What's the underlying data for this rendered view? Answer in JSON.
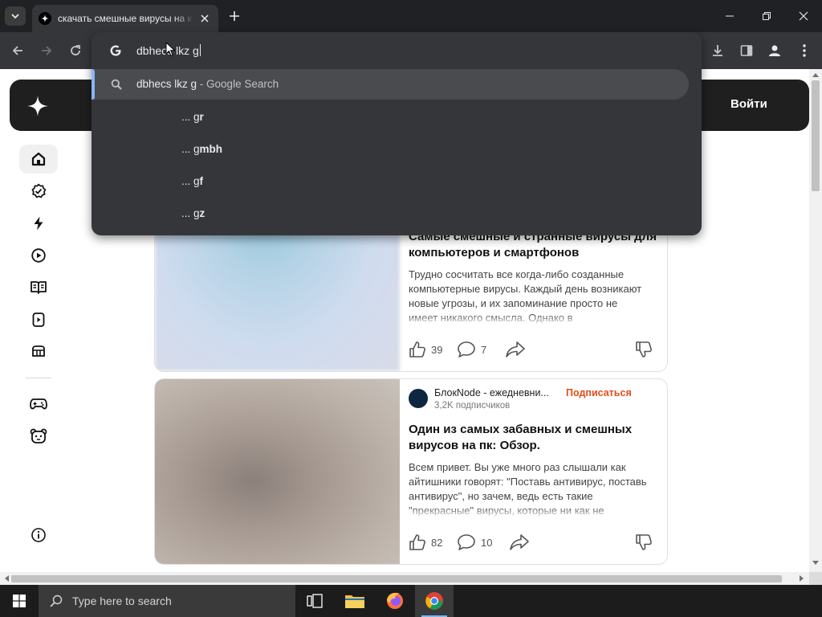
{
  "browser": {
    "tab": {
      "title": "скачать смешные вирусы на к"
    },
    "omnibox": {
      "typed_text": "dbhecs lkz g",
      "selected_suggestion": {
        "query": "dbhecs lkz g",
        "suffix": " - Google Search"
      },
      "suggestions": [
        {
          "prefix": "... g",
          "bold": "r"
        },
        {
          "prefix": "... g",
          "bold": "mbh"
        },
        {
          "prefix": "... g",
          "bold": "f"
        },
        {
          "prefix": "... g",
          "bold": "z"
        }
      ]
    }
  },
  "site": {
    "login_label": "Войти",
    "nav_icons": [
      "home-icon",
      "popular-icon",
      "lightning-icon",
      "video-icon",
      "book-icon",
      "tv-icon",
      "cube-icon",
      "gamepad-icon",
      "bear-icon",
      "info-icon"
    ]
  },
  "articles": [
    {
      "title_line1": "Самые смешные и странные вирусы для",
      "title_line2": "компьютеров и смартфонов",
      "text": "Трудно сосчитать все когда-либо созданные компьютерные вирусы. Каждый день возникают новые угрозы, и их запоминание просто не имеет никакого смысла. Однако в",
      "likes": "39",
      "comments": "7"
    },
    {
      "author": "БлокNode - ежедневни...",
      "subscribe_label": "Подписаться",
      "subscribers": "3,2K подписчиков",
      "title_line1": "Один из самых забавных и смешных",
      "title_line2": "вирусов на пк: Обзор.",
      "text": "Всем привет. Вы уже много раз слышали как айтишники говорят: \"Поставь антивирус, поставь антивирус\", но зачем, ведь есть такие \"прекрасные\" вирусы, которые ни как не",
      "likes": "82",
      "comments": "10"
    }
  ],
  "taskbar": {
    "search_placeholder": "Type here to search"
  },
  "colors": {
    "accent_subscribe": "#e04e1a",
    "omnibox_focus": "#8ab4f8"
  }
}
